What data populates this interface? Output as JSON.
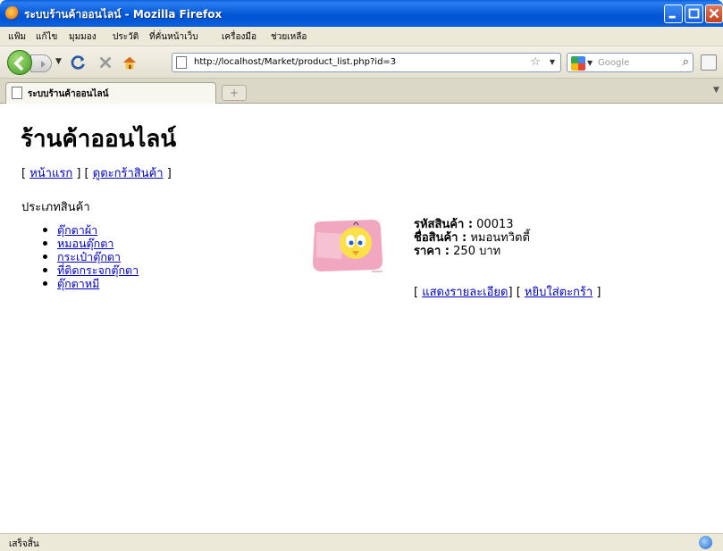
{
  "window": {
    "title": "ระบบร้านค้าออนไลน์ - Mozilla Firefox"
  },
  "menu": {
    "items": [
      "แฟ้ม",
      "แก้ไข",
      "มุมมอง",
      "ประวัติ",
      "ที่คั่นหน้าเว็บ",
      "เครื่องมือ",
      "ช่วยเหลือ"
    ]
  },
  "navbar": {
    "url": "http://localhost/Market/product_list.php?id=3",
    "search_placeholder": "Google"
  },
  "tab": {
    "label": "ระบบร้านค้าออนไลน์",
    "new_tab_symbol": "+"
  },
  "page": {
    "shop_title": "ร้านค้าออนไลน์",
    "nav": {
      "open": "[ ",
      "home": "หน้าแรก",
      "mid": " ] [ ",
      "cart": "ดูตะกร้าสินค้า",
      "close": " ]"
    },
    "category_heading": "ประเภทสินค้า",
    "categories": [
      "ตุ๊กตาผ้า",
      "หมอนตุ๊กตา",
      "กระเป๋าตุ๊กตา",
      "ที่ติดกระจกตุ๊กตา",
      "ตุ๊กตาหมี"
    ],
    "product": {
      "code_label": "รหัสสินค้า :",
      "code": " 00013",
      "name_label": "ชื่อสินค้า :",
      "name": " หมอนทวิตตี้",
      "price_label": "ราคา :",
      "price": " 250 บาท",
      "actions": {
        "open": "[ ",
        "detail": "แสดงรายละเอียด",
        "mid": "] [ ",
        "add": "หยิบใส่ตะกร้า",
        "close": " ]"
      }
    }
  },
  "status": {
    "text": "เสร็จสิ้น"
  }
}
